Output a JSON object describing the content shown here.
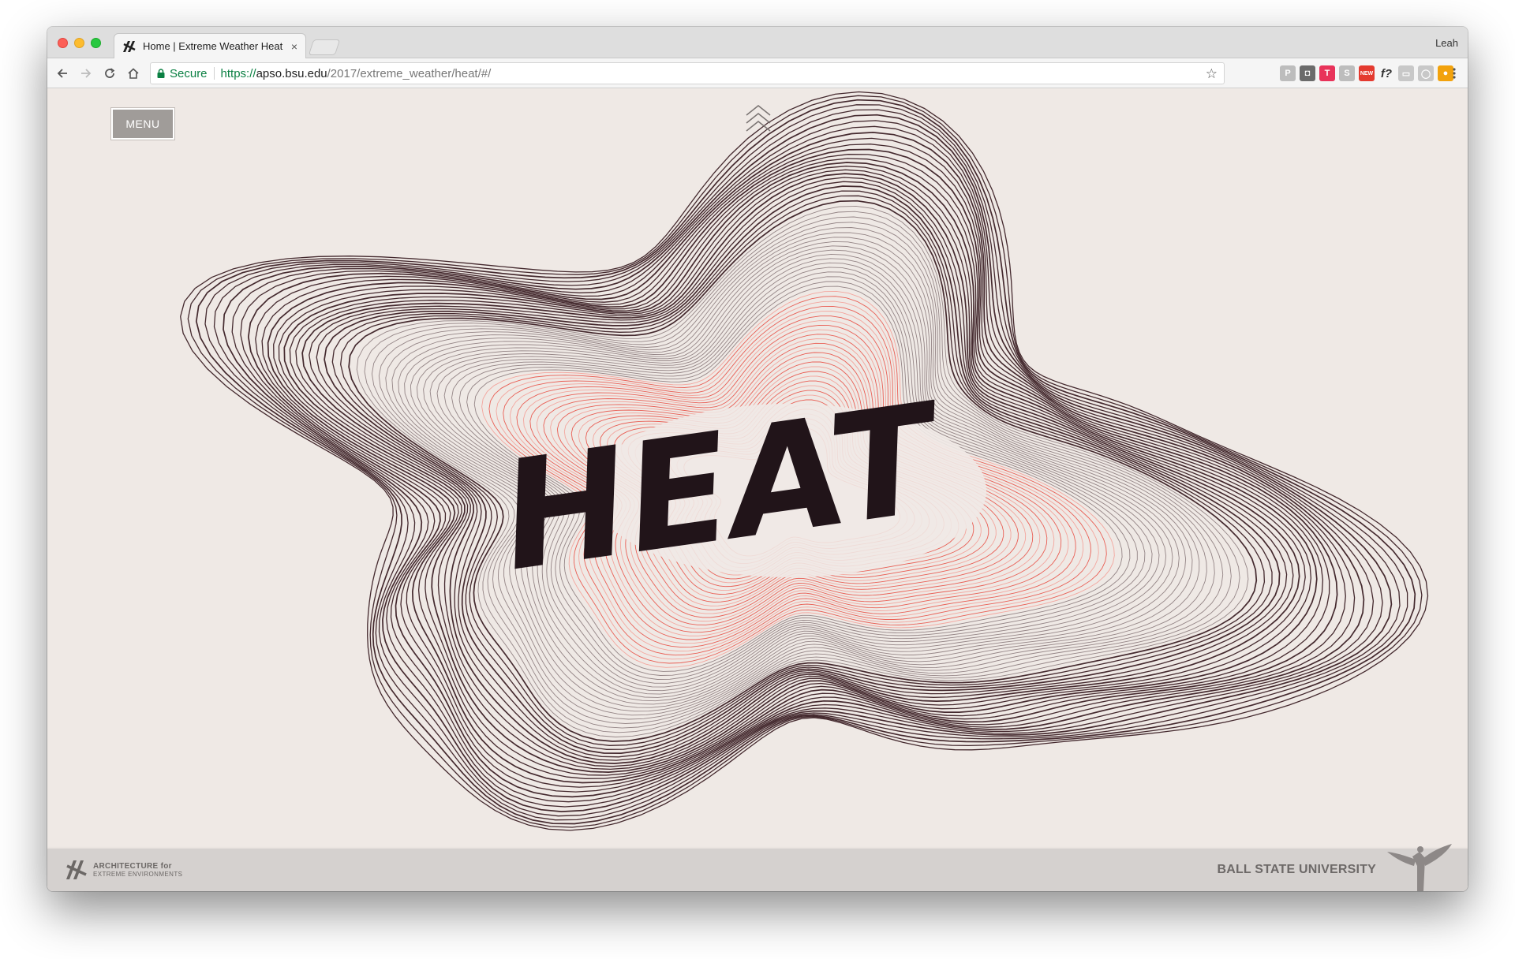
{
  "browser": {
    "tab_title": "Home | Extreme Weather Heat",
    "tab_close": "×",
    "profile_name": "Leah",
    "secure_label": "Secure",
    "url_scheme": "https://",
    "url_host": "apso.bsu.edu",
    "url_path": "/2017/extreme_weather/heat/#/",
    "extensions": [
      {
        "name": "p-extension",
        "glyph": "P",
        "color": "#bdbdbd"
      },
      {
        "name": "pocket-extension",
        "glyph": "◘",
        "color": "#6b6b6b"
      },
      {
        "name": "tmetric-extension",
        "glyph": "T",
        "color": "#e8335a"
      },
      {
        "name": "s-extension",
        "glyph": "S",
        "color": "#bdbdbd"
      },
      {
        "name": "new-badge-extension",
        "glyph": "NEW",
        "color": "#e43a2f"
      },
      {
        "name": "whatfont-extension",
        "glyph": "f?",
        "color": "#333333"
      },
      {
        "name": "grey-extension",
        "glyph": "▭",
        "color": "#c8c8c8"
      },
      {
        "name": "circle-extension",
        "glyph": "◯",
        "color": "#c8c8c8"
      },
      {
        "name": "colorpick-extension",
        "glyph": "●",
        "color": "#f2a20c"
      }
    ]
  },
  "page": {
    "menu_label": "MENU",
    "hero_word": "HEAT",
    "footer_logo_line1": "ARCHITECTURE for",
    "footer_logo_line2": "EXTREME ENVIRONMENTS",
    "footer_university": "BALL STATE UNIVERSITY"
  },
  "colors": {
    "page_bg": "#efe9e5",
    "line_dark": "#3a1f24",
    "line_red": "#e8463c",
    "word_fill": "#211419",
    "footer_bg": "#d5d1cf",
    "menu_bg": "#a09c99"
  }
}
